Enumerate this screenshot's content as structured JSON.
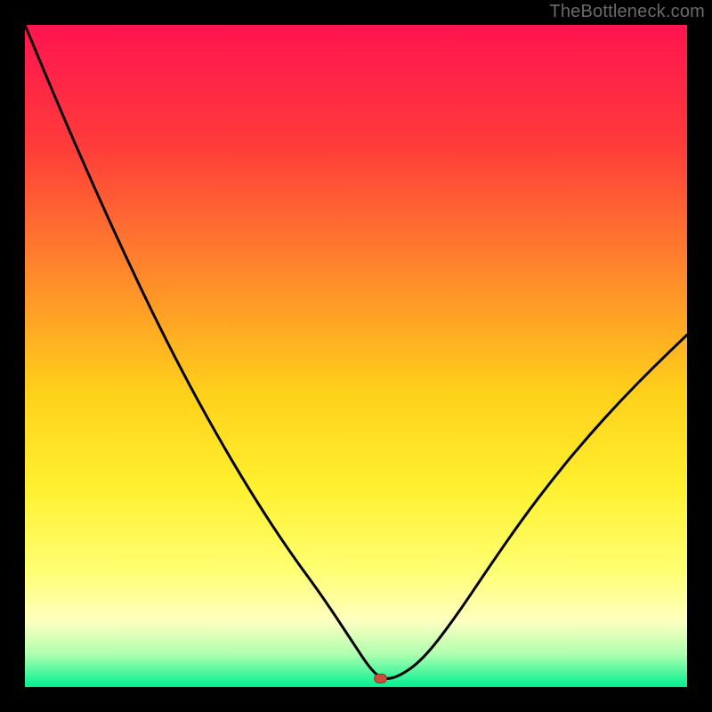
{
  "watermark": "TheBottleneck.com",
  "chart_data": {
    "type": "line",
    "title": "",
    "xlabel": "",
    "ylabel": "",
    "xlim": [
      0,
      100
    ],
    "ylim": [
      0,
      100
    ],
    "x": [
      0,
      5,
      10,
      15,
      20,
      25,
      30,
      35,
      40,
      45,
      50,
      52,
      53.7,
      56,
      60,
      65,
      70,
      75,
      80,
      85,
      90,
      95,
      100
    ],
    "values": [
      100,
      88,
      76.5,
      65.5,
      55,
      45.3,
      36.3,
      28,
      20.4,
      13.6,
      6,
      3,
      1.3,
      1.3,
      4,
      10.5,
      18,
      25.2,
      31.8,
      37.8,
      43.3,
      48.4,
      53.2
    ],
    "marker": {
      "x": 53.7,
      "y": 1.3,
      "color": "#d04a40"
    },
    "gradient_stops": [
      {
        "offset": 0.0,
        "color": "#ff1450"
      },
      {
        "offset": 0.18,
        "color": "#ff3b3b"
      },
      {
        "offset": 0.38,
        "color": "#ff8a2b"
      },
      {
        "offset": 0.56,
        "color": "#ffd21a"
      },
      {
        "offset": 0.7,
        "color": "#fff030"
      },
      {
        "offset": 0.82,
        "color": "#ffff70"
      },
      {
        "offset": 0.9,
        "color": "#ffffc0"
      },
      {
        "offset": 0.95,
        "color": "#b0ffb0"
      },
      {
        "offset": 1.0,
        "color": "#00f090"
      }
    ]
  }
}
